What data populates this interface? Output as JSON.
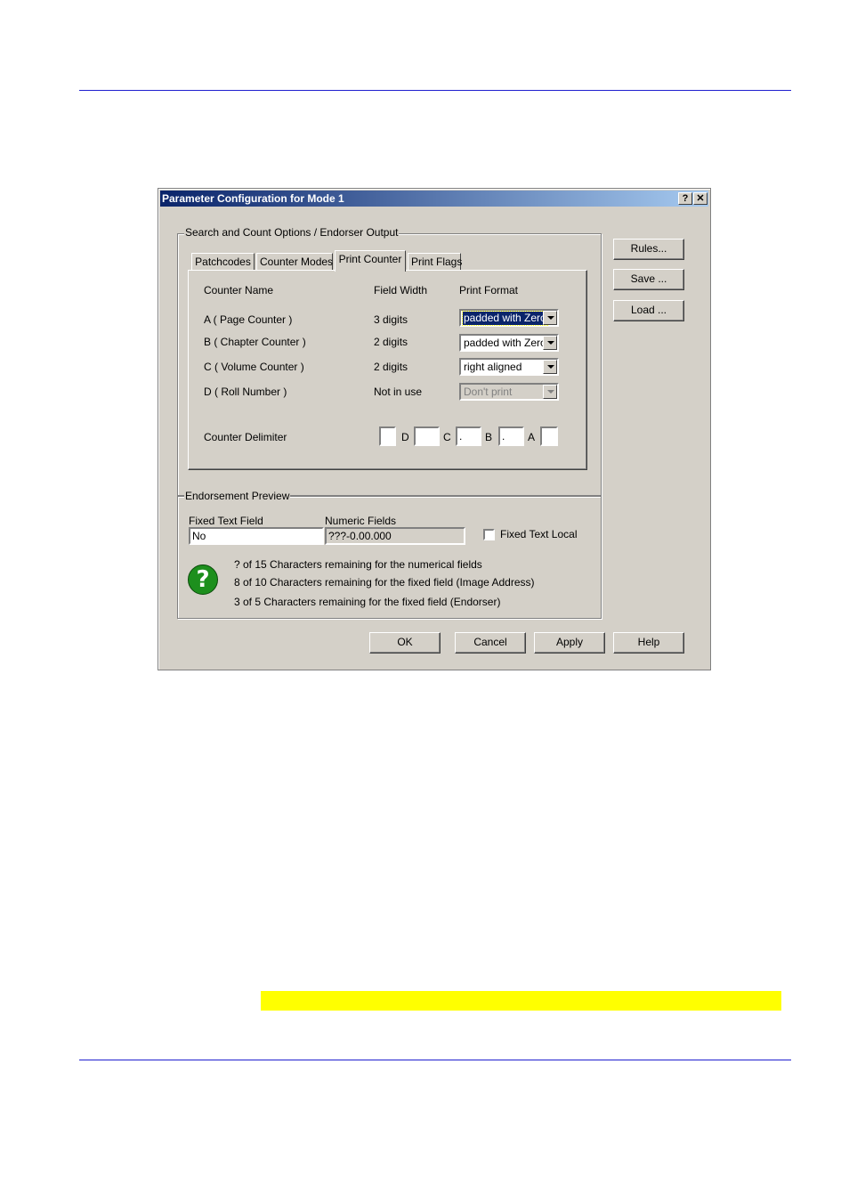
{
  "dialog": {
    "title": "Parameter Configuration for Mode 1",
    "help_btn": "?",
    "close_btn": "✕"
  },
  "side_buttons": {
    "rules": "Rules...",
    "save": "Save ...",
    "load": "Load ..."
  },
  "search_group": {
    "legend": "Search and Count Options / Endorser Output"
  },
  "tabs": [
    {
      "label": "Patchcodes"
    },
    {
      "label": "Counter Modes"
    },
    {
      "label": "Print Counter"
    },
    {
      "label": "Print Flags"
    }
  ],
  "print_counter": {
    "headers": {
      "name": "Counter Name",
      "width": "Field Width",
      "format": "Print Format"
    },
    "rows": [
      {
        "name": "A ( Page Counter )",
        "width": "3 digits",
        "format": "padded with Zero"
      },
      {
        "name": "B ( Chapter Counter )",
        "width": "2 digits",
        "format": "padded with Zero"
      },
      {
        "name": "C ( Volume Counter )",
        "width": "2 digits",
        "format": "right aligned"
      },
      {
        "name": "D ( Roll Number )",
        "width": "Not in use",
        "format": "Don't print"
      }
    ],
    "delimiter": {
      "label": "Counter Delimiter",
      "fields": [
        "",
        "",
        ".",
        ".",
        ""
      ],
      "letters": [
        "D",
        "C",
        "B",
        "A"
      ]
    }
  },
  "preview": {
    "legend": "Endorsement Preview",
    "fixed_label": "Fixed Text Field",
    "fixed_value": "No",
    "numeric_label": "Numeric Fields",
    "numeric_value": "???-0.00.000",
    "fixed_local_label": "Fixed Text Local",
    "info_icon": "?",
    "messages": [
      "? of 15 Characters remaining for the numerical fields",
      "8 of 10 Characters remaining for the fixed field (Image Address)",
      "3 of 5 Characters remaining for the fixed field (Endorser)"
    ]
  },
  "bottom_buttons": {
    "ok": "OK",
    "cancel": "Cancel",
    "apply": "Apply",
    "help": "Help"
  },
  "colors": {
    "title_bar": "#0a246a",
    "highlight": "#ffff00",
    "rule": "#1f1fcf"
  }
}
